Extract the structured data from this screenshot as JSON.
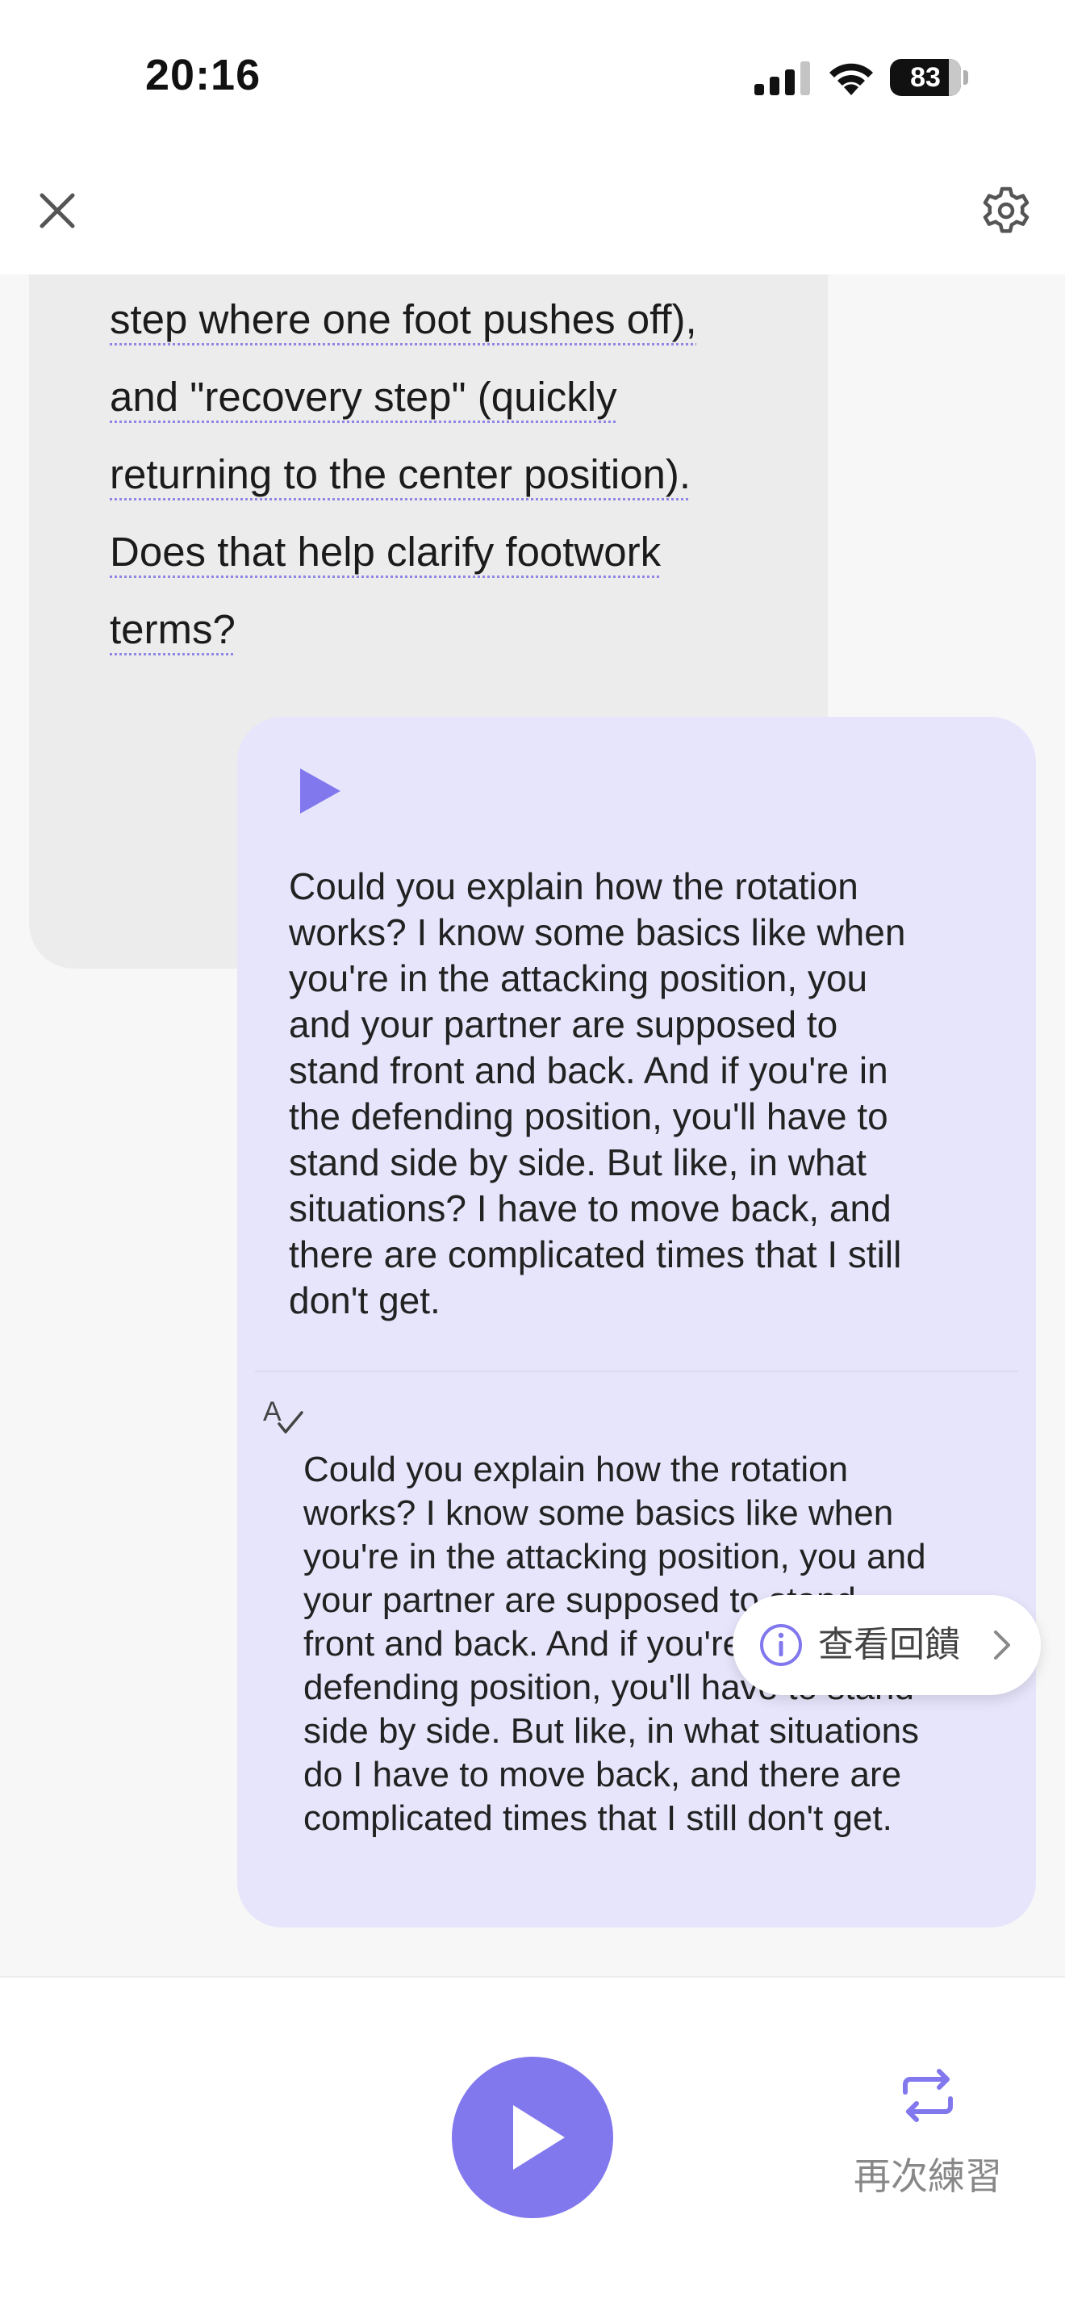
{
  "status_bar": {
    "time": "20:16",
    "battery": "83"
  },
  "header": {
    "close_icon": "close-icon",
    "settings_icon": "gear-icon"
  },
  "ai_message": {
    "lines": [
      "step where one foot pushes off),",
      "and \"recovery step\" (quickly",
      "returning to the center position).",
      "Does that help clarify footwork",
      "terms?"
    ]
  },
  "user_message": {
    "original_lines": [
      "Could you explain how the rotation",
      "works? I know some basics like when",
      "you're in the attacking position, you",
      "and your partner are supposed to",
      "stand front and back. And if you're in",
      "the defending position, you'll have to",
      "stand side by side. But like, in what",
      "situations? I have to move back, and",
      "there are complicated times that I still",
      "don't get."
    ],
    "corrected_lines": [
      "Could you explain how the rotation",
      "works? I know some basics like when",
      "you're in the attacking position, you and",
      "your partner are supposed to stand",
      "front and back. And if you're in the",
      "defending position, you'll have to stand",
      "side by side. But like, in what situations",
      "do I have to move back, and there are",
      "complicated times that I still don't get."
    ]
  },
  "feedback_button": {
    "label": "查看回饋"
  },
  "bottom_bar": {
    "repeat_label": "再次練習"
  },
  "colors": {
    "accent": "#8278ee",
    "user_bubble": "#e7e5fb",
    "ai_bubble": "#ececec"
  }
}
